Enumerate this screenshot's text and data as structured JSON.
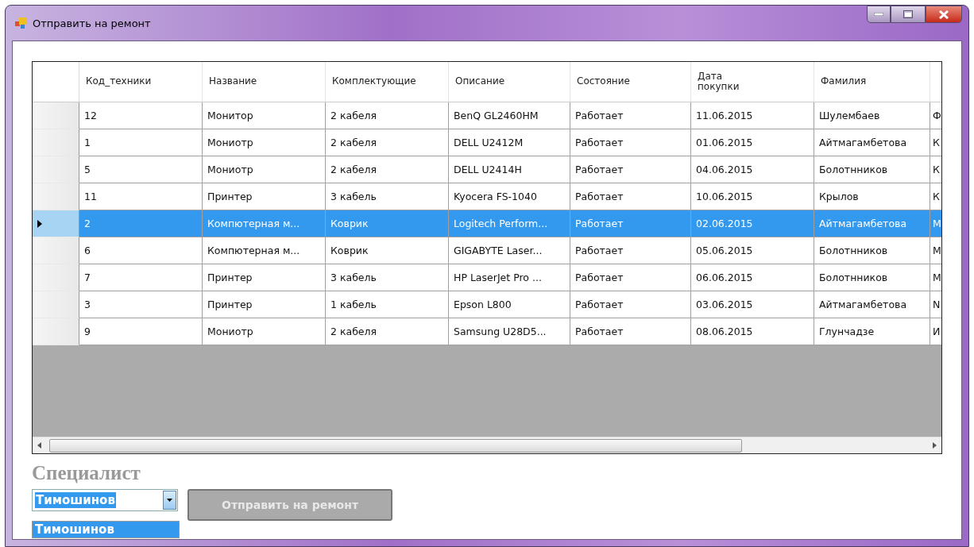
{
  "window": {
    "title": "Отправить на ремонт"
  },
  "table": {
    "columns": [
      "Код_техники",
      "Название",
      "Комплектующие",
      "Описание",
      "Состояние",
      "Дата покупки",
      "Фамилия",
      ""
    ],
    "rows": [
      {
        "selected": false,
        "cells": [
          "12",
          "Монитор",
          "2 кабеля",
          "BenQ GL2460HM",
          "Работает",
          "11.06.2015",
          "Шулембаев",
          "Ф"
        ]
      },
      {
        "selected": false,
        "cells": [
          "1",
          "Мониотр",
          "2 кабеля",
          "DELL U2412M",
          "Работает",
          "01.06.2015",
          "Айтмагамбетова",
          "К"
        ]
      },
      {
        "selected": false,
        "cells": [
          "5",
          "Мониотр",
          "2 кабеля",
          "DELL U2414H",
          "Работает",
          "04.06.2015",
          "Болотнников",
          "К"
        ]
      },
      {
        "selected": false,
        "cells": [
          "11",
          "Принтер",
          "3 кабель",
          "Kyocera FS-1040",
          "Работает",
          "10.06.2015",
          "Крылов",
          "К"
        ]
      },
      {
        "selected": true,
        "cells": [
          "2",
          "Компютерная м...",
          "Коврик",
          "Logitech Perform...",
          "Работает",
          "02.06.2015",
          "Айтмагамбетова",
          "М"
        ]
      },
      {
        "selected": false,
        "cells": [
          "6",
          "Компютерная м...",
          "Коврик",
          "GIGABYTE Laser...",
          "Работает",
          "05.06.2015",
          "Болотнников",
          "М"
        ]
      },
      {
        "selected": false,
        "cells": [
          "7",
          "Принтер",
          "3 кабель",
          "HP LaserJet Pro ...",
          "Работает",
          "06.06.2015",
          "Болотнников",
          "М"
        ]
      },
      {
        "selected": false,
        "cells": [
          "3",
          "Принтер",
          "1 кабель",
          "Epson L800",
          "Работает",
          "03.06.2015",
          "Айтмагамбетова",
          "N"
        ]
      },
      {
        "selected": false,
        "cells": [
          "9",
          "Мониотр",
          "2 кабеля",
          "Samsung U28D5...",
          "Работает",
          "08.06.2015",
          "Глунчадзе",
          "И"
        ]
      }
    ]
  },
  "specialist": {
    "label": "Специалист",
    "value": "Тимошинов",
    "options": [
      {
        "label": "Тимошинов",
        "selected": true
      }
    ]
  },
  "send_button": {
    "label": "Отправить на ремонт",
    "disabled": true
  }
}
